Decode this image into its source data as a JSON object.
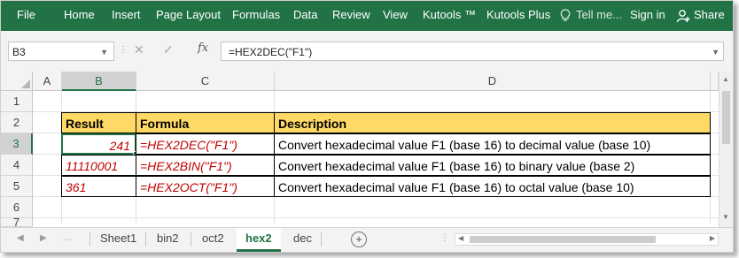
{
  "ribbon": {
    "tabs": [
      "File",
      "Home",
      "Insert",
      "Page Layout",
      "Formulas",
      "Data",
      "Review",
      "View",
      "Kutools ™",
      "Kutools Plus"
    ],
    "tell_me": "Tell me...",
    "sign_in": "Sign in",
    "share": "Share"
  },
  "formula_bar": {
    "name_box": "B3",
    "cancel_symbol": "✕",
    "enter_symbol": "✓",
    "fx": "fx",
    "formula": "=HEX2DEC(\"F1\")"
  },
  "grid": {
    "columns": [
      "A",
      "B",
      "C",
      "D"
    ],
    "rows": [
      "1",
      "2",
      "3",
      "4",
      "5",
      "6",
      "7"
    ],
    "selected_column": "B",
    "selected_row": "3"
  },
  "table": {
    "headers": [
      "Result",
      "Formula",
      "Description"
    ],
    "rows": [
      {
        "result": "241",
        "formula": "=HEX2DEC(\"F1\")",
        "description": "Convert hexadecimal value F1 (base 16)  to decimal value (base 10)"
      },
      {
        "result": "11110001",
        "formula": "=HEX2BIN(\"F1\")",
        "description": "Convert hexadecimal value F1 (base 16)  to binary value (base 2)"
      },
      {
        "result": "361",
        "formula": "=HEX2OCT(\"F1\")",
        "description": "Convert hexadecimal value F1 (base 16)  to octal value (base 10)"
      }
    ]
  },
  "sheets": {
    "tabs": [
      "Sheet1",
      "bin2",
      "oct2",
      "hex2",
      "dec"
    ],
    "active": "hex2",
    "add_symbol": "+"
  },
  "colors": {
    "ribbon": "#217346",
    "header_fill": "#ffd966",
    "data_text": "#c00000"
  }
}
